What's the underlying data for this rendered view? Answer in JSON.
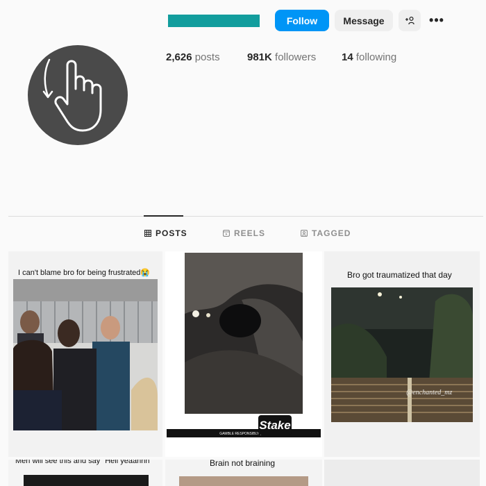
{
  "profile": {
    "follow_label": "Follow",
    "message_label": "Message",
    "more_label": "•••",
    "suggest_label": "+👤"
  },
  "stats": {
    "posts_count": "2,626",
    "posts_label": "posts",
    "followers_count": "981K",
    "followers_label": "followers",
    "following_count": "14",
    "following_label": "following"
  },
  "tabs": [
    {
      "label": "POSTS",
      "icon": "grid-icon",
      "active": true
    },
    {
      "label": "REELS",
      "icon": "reels-icon",
      "active": false
    },
    {
      "label": "TAGGED",
      "icon": "tagged-icon",
      "active": false
    }
  ],
  "posts": [
    {
      "caption": "I can't blame bro for being frustrated😭"
    },
    {
      "caption": "",
      "brand": "Stake",
      "footer": "GAMBLE RESPONSIBLY | 18+"
    },
    {
      "caption": "Bro got traumatized that day",
      "watermark": "@enchanted_mz"
    },
    {
      "caption": "Men will see this and say \"Hell yeaahhh\""
    },
    {
      "caption": "Brain not braining"
    },
    {
      "caption": ""
    }
  ],
  "colors": {
    "follow_button": "#0095f6",
    "username_redaction": "#129d9d",
    "avatar_bg": "#4a4a4a"
  }
}
